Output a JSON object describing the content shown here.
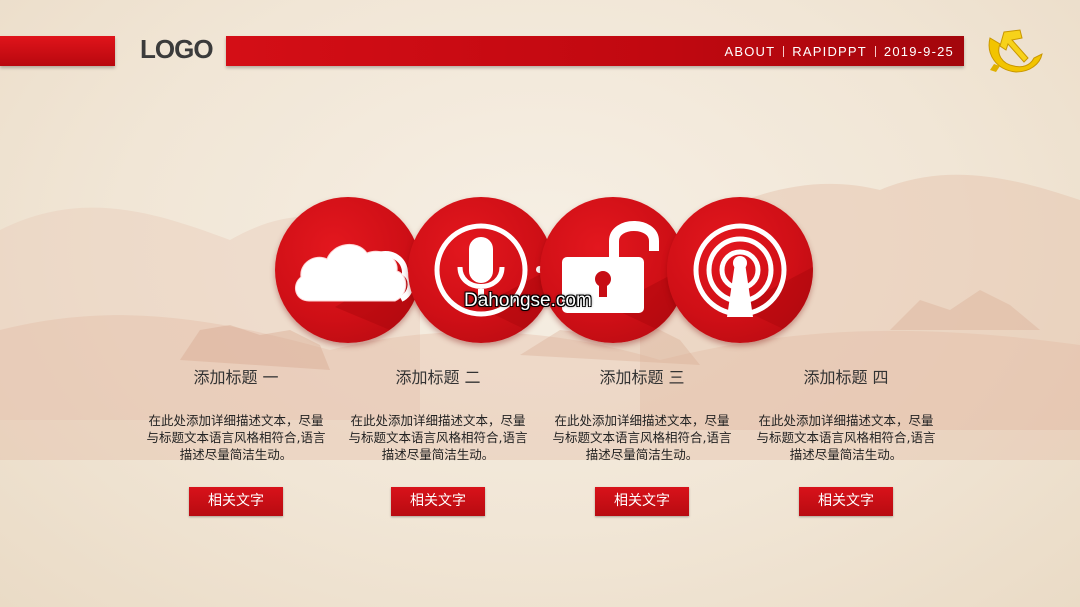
{
  "header": {
    "logo": "LOGO",
    "about": "ABOUT",
    "brand": "RAPIDPPT",
    "date": "2019-9-25",
    "emblem_icon": "party-emblem-icon"
  },
  "icons": [
    "cloud-icon",
    "microphone-icon",
    "padlock-icon",
    "broadcast-icon"
  ],
  "watermark": "Dahongse.com",
  "columns": [
    {
      "title": "添加标题 一",
      "desc": "在此处添加详细描述文本，尽量与标题文本语言风格相符合,语言描述尽量简洁生动。",
      "button": "相关文字"
    },
    {
      "title": "添加标题  二",
      "desc": "在此处添加详细描述文本，尽量与标题文本语言风格相符合,语言描述尽量简洁生动。",
      "button": "相关文字"
    },
    {
      "title": "添加标题  三",
      "desc": "在此处添加详细描述文本，尽量与标题文本语言风格相符合,语言描述尽量简洁生动。",
      "button": "相关文字"
    },
    {
      "title": "添加标题  四",
      "desc": "在此处添加详细描述文本，尽量与标题文本语言风格相符合,语言描述尽量简洁生动。",
      "button": "相关文字"
    }
  ],
  "colors": {
    "accent": "#d0121a",
    "background": "#f3eadc",
    "text": "#333333"
  }
}
